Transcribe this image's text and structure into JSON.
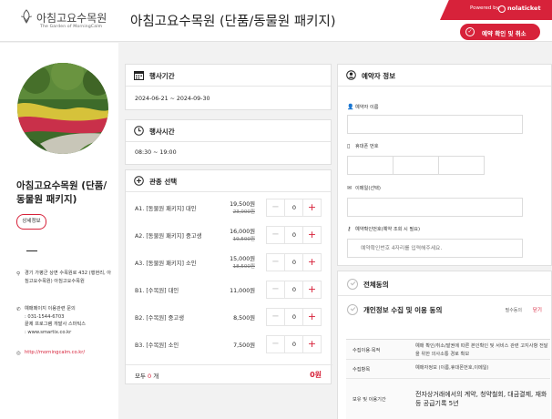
{
  "header": {
    "logo_korean": "아침고요수목원",
    "logo_english": "The Garden of MorningCalm",
    "title": "아침고요수목원 (단품/동물원 패키지)",
    "powered_label": "Powered by",
    "powered_brand": "nolaticket",
    "confirm_cancel_button": "예약 확인 및 취소"
  },
  "venue": {
    "name": "아침고요수목원 (단품/동물원 패키지)",
    "detail_button": "상세정보",
    "address": "경기 가평군 상면 수목원로 432 (행현리, 아침고요수목원) 아침고요수목원",
    "contact_title": "예매페이지 이용관련 문의",
    "contact_phone": ": 031-1544-6703",
    "contact_company": "끝제 프로그램 개발사 스마틱스",
    "contact_site": ": www.smartix.co.kr",
    "homepage": "http://morningcalm.co.kr/"
  },
  "period": {
    "heading": "행사기간",
    "value": "2024-06-21 ~ 2024-09-30"
  },
  "hours": {
    "heading": "행사시간",
    "value": "08:30 ~ 19:00"
  },
  "tickets": {
    "heading": "관종 선택",
    "items": [
      {
        "name": "A1. [동물원 패키지] 대인",
        "price": "19,500원",
        "original": "23,000원",
        "qty": "0"
      },
      {
        "name": "A2. [동물원 패키지] 중고생",
        "price": "16,000원",
        "original": "19,500원",
        "qty": "0"
      },
      {
        "name": "A3. [동물원 패키지] 소인",
        "price": "15,000원",
        "original": "18,500원",
        "qty": "0"
      },
      {
        "name": "B1. [수목원] 대인",
        "price": "11,000원",
        "original": "",
        "qty": "0"
      },
      {
        "name": "B2. [수목원] 중고생",
        "price": "8,500원",
        "original": "",
        "qty": "0"
      },
      {
        "name": "B3. [수목원] 소인",
        "price": "7,500원",
        "original": "",
        "qty": "0"
      }
    ],
    "total_prefix": "모두 ",
    "total_count": "0",
    "total_suffix": " 개",
    "total_amount": "0원"
  },
  "booker": {
    "heading": "예약자 정보",
    "name_label": "예약자 이름",
    "phone_label": "휴대폰 번호",
    "email_label": "이메일(선택)",
    "password_label": "예약확인번호(예약 조회 시 필요)",
    "password_placeholder": "예약확인번호 4자리를 입력해주세요."
  },
  "agreement": {
    "all_title": "전체동의",
    "privacy_title": "개인정보 수집 및 이용 동의",
    "required_tag": "필수동의",
    "close_link": "닫기",
    "terms": [
      {
        "key": "수집이용·목적",
        "value": "예매 확인/취소/발권에 따른 본인확인 및 서비스 관련 고지사항 전달을 위한 의사소통 경로 확보"
      },
      {
        "key": "수집항목",
        "value": "예매자정보 (이름,휴대폰번호,이메일)"
      },
      {
        "key": "보유 및 이용기간",
        "value": "전자상거래에서의 계약, 청약철회, 대금결제, 재화 등 공급기록 5년"
      }
    ]
  },
  "colors": {
    "accent": "#d7223a",
    "background": "#f2f2f2",
    "panel": "#ffffff"
  }
}
